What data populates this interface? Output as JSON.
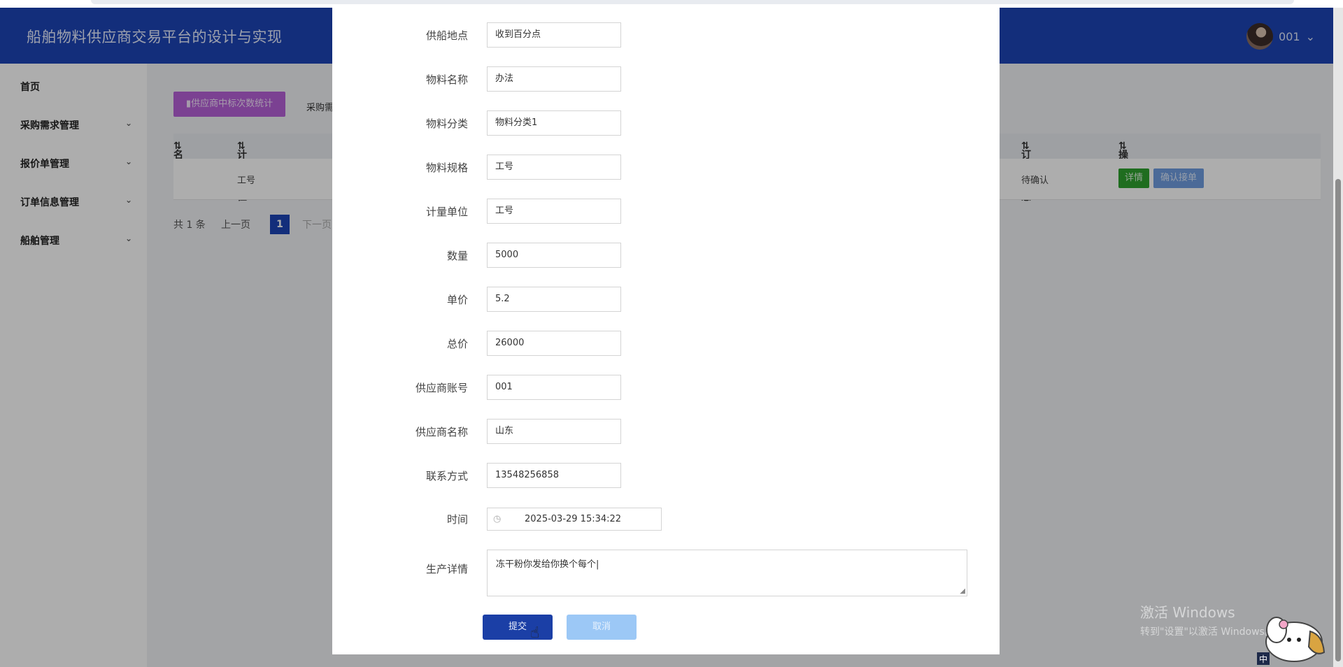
{
  "app": {
    "title": "船舶物料供应商交易平台的设计与实现",
    "username": "001"
  },
  "sidebar": {
    "items": [
      {
        "label": "首页",
        "has_submenu": false
      },
      {
        "label": "采购需求管理",
        "has_submenu": true
      },
      {
        "label": "报价单管理",
        "has_submenu": true
      },
      {
        "label": "订单信息管理",
        "has_submenu": true
      },
      {
        "label": "船舶管理",
        "has_submenu": true
      }
    ]
  },
  "main": {
    "stat_button": "供应商中标次数统计",
    "breadcrumb": "采购需",
    "table": {
      "headers": [
        "名",
        "计量单位",
        "订单状态",
        "操作"
      ],
      "row": {
        "unit": "工号",
        "status": "待确认",
        "detail": "详情",
        "confirm": "确认接单"
      }
    },
    "pager": {
      "total": "共 1 条",
      "prev": "上一页",
      "page": "1",
      "next": "下一页"
    }
  },
  "modal": {
    "fields": [
      {
        "label": "供船地点",
        "value": "收到百分点"
      },
      {
        "label": "物料名称",
        "value": "办法"
      },
      {
        "label": "物料分类",
        "value": "物料分类1"
      },
      {
        "label": "物料规格",
        "value": "工号"
      },
      {
        "label": "计量单位",
        "value": "工号"
      },
      {
        "label": "数量",
        "value": "5000"
      },
      {
        "label": "单价",
        "value": "5.2"
      },
      {
        "label": "总价",
        "value": "26000"
      },
      {
        "label": "供应商账号",
        "value": "001"
      },
      {
        "label": "供应商名称",
        "value": "山东"
      },
      {
        "label": "联系方式",
        "value": "13548256858"
      }
    ],
    "time": {
      "label": "时间",
      "value": "2025-03-29 15:34:22"
    },
    "detail": {
      "label": "生产详情",
      "value": "冻干粉你发给你换个每个|"
    },
    "submit": "提交",
    "cancel": "取消"
  },
  "watermark": {
    "line1": "激活 Windows",
    "line2": "转到\"设置\"以激活 Windows。"
  },
  "colors": {
    "header": "#1d45b5",
    "submit": "#1b3fa6",
    "cancel": "#9cc8f6",
    "detail_btn": "#2ea12e",
    "stat_btn": "#b561d8"
  }
}
